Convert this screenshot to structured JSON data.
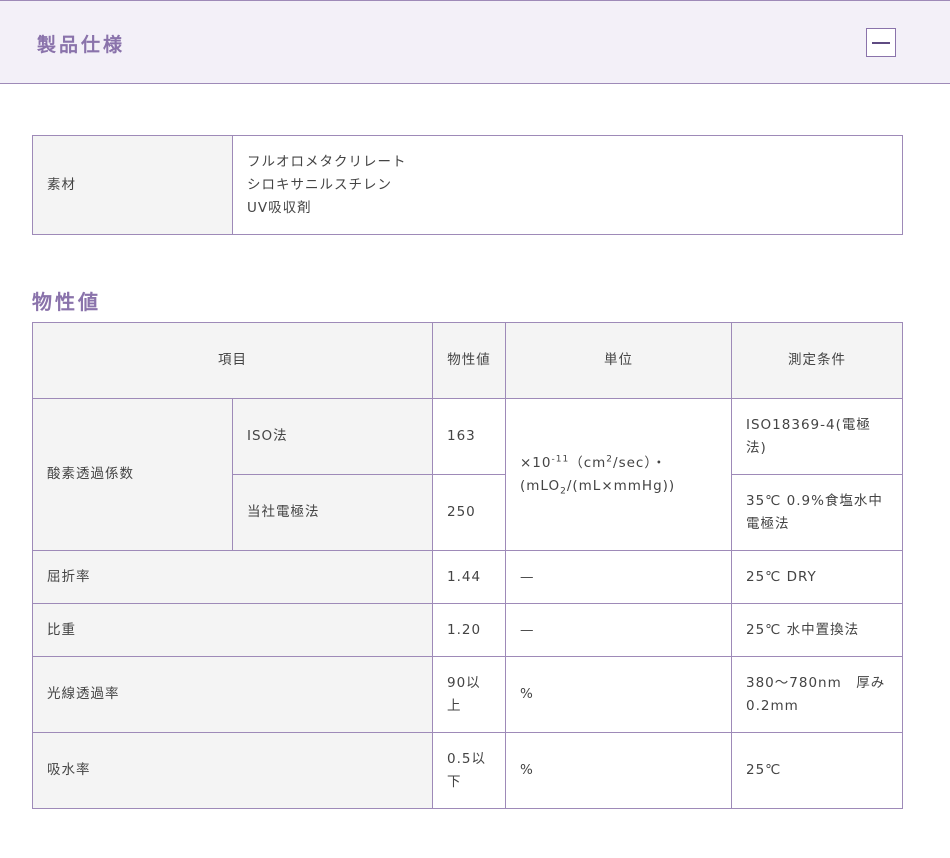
{
  "accordion": {
    "title": "製品仕様",
    "toggle_icon": "minus-icon"
  },
  "material": {
    "label": "素材",
    "values": [
      "フルオロメタクリレート",
      "シロキサニルスチレン",
      "UV吸収剤"
    ]
  },
  "properties": {
    "title": "物性値",
    "headers": {
      "item": "項目",
      "value": "物性値",
      "unit": "単位",
      "condition": "測定条件"
    },
    "oxygen": {
      "label": "酸素透過係数",
      "unit": {
        "prefix": "×10",
        "exp": "-11",
        "cm": "（cm",
        "cm_exp": "2",
        "sec": "/sec）・",
        "mlo": "(mLO",
        "mlo_sub": "2",
        "rest": "/(mL×mmHg))"
      },
      "methods": [
        {
          "name": "ISO法",
          "value": "163",
          "condition": "ISO18369-4(電極法)"
        },
        {
          "name": "当社電極法",
          "value": "250",
          "condition": "35℃ 0.9%食塩水中電極法"
        }
      ]
    },
    "rows": [
      {
        "item": "屈折率",
        "value": "1.44",
        "unit": "—",
        "condition": "25℃ DRY"
      },
      {
        "item": "比重",
        "value": "1.20",
        "unit": "—",
        "condition": "25℃ 水中置換法"
      },
      {
        "item": "光線透過率",
        "value": "90以上",
        "unit": "%",
        "condition": "380～780nm　厚み0.2mm"
      },
      {
        "item": "吸水率",
        "value": "0.5以下",
        "unit": "%",
        "condition": "25℃"
      }
    ]
  }
}
